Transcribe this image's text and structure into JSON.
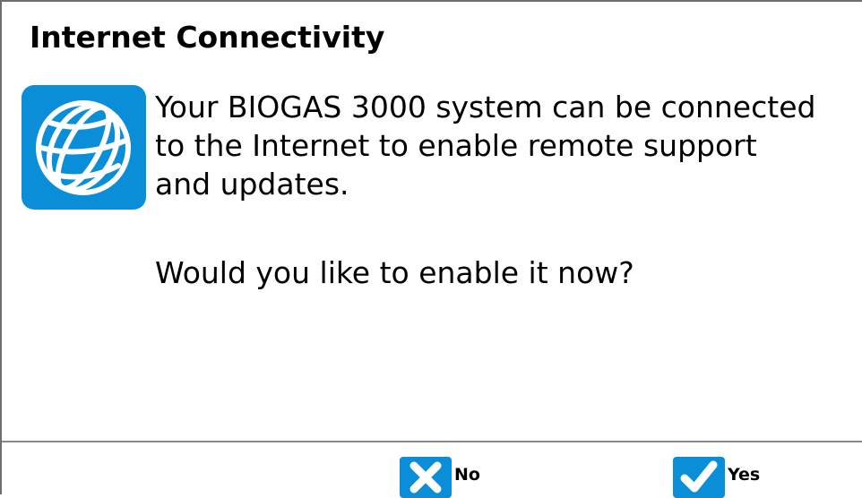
{
  "dialog": {
    "title": "Internet Connectivity",
    "icon": "globe-icon",
    "message_lines": [
      "Your BIOGAS 3000 system can be connected",
      "to the Internet to enable remote support",
      "and updates."
    ],
    "question": "Would you like to enable it now?"
  },
  "buttons": {
    "no": {
      "label": "No",
      "icon": "close-icon"
    },
    "yes": {
      "label": "Yes",
      "icon": "check-icon"
    }
  },
  "colors": {
    "accent": "#0a8ed8",
    "text": "#000000",
    "border": "#6e6e6e"
  }
}
